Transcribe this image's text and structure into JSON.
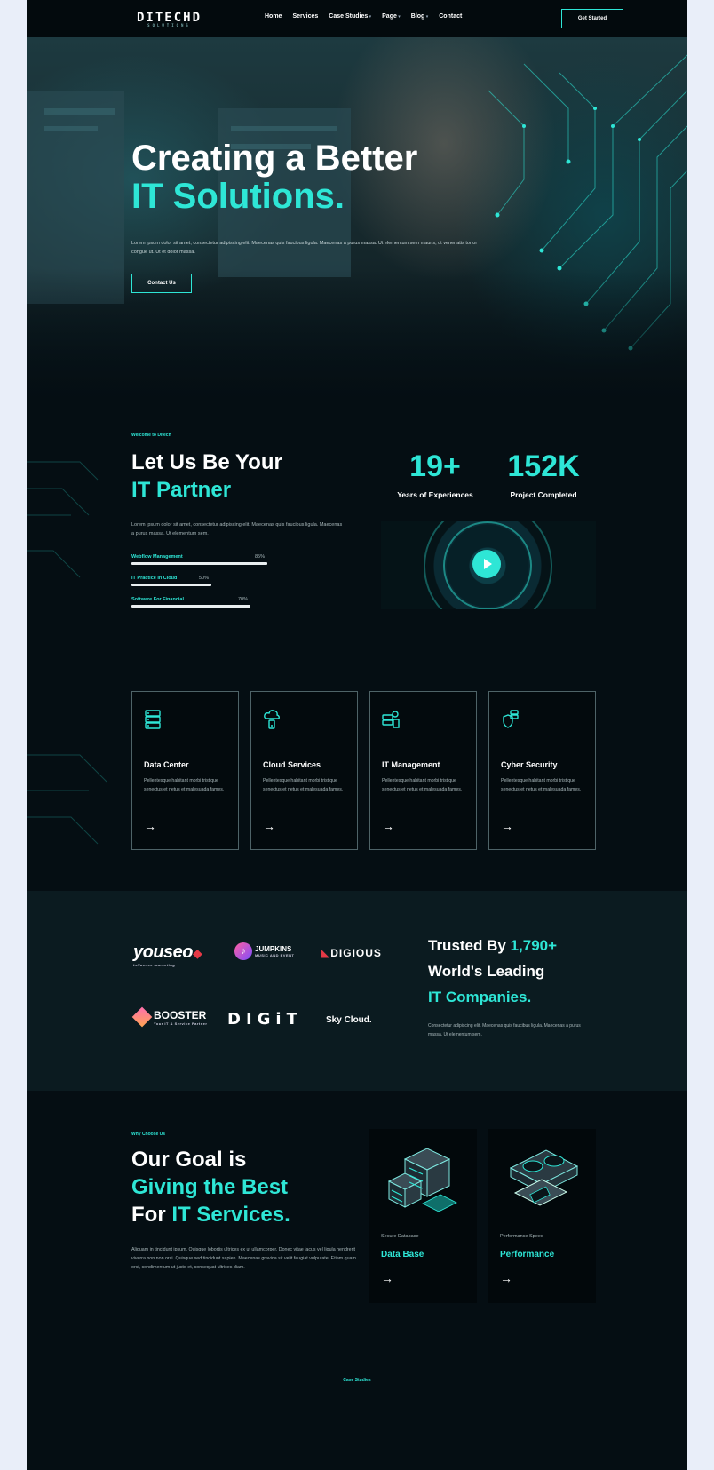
{
  "nav": {
    "logo": "DITECHD",
    "logo_tag": "SOLUTIONS",
    "menu": [
      "Home",
      "Services",
      "Case Studies",
      "Page",
      "Blog",
      "Contact"
    ],
    "menu_has_caret": [
      false,
      false,
      true,
      true,
      true,
      false
    ],
    "cta": "Get Started"
  },
  "hero": {
    "title_line1": "Creating a Better",
    "title_line2": "IT Solutions.",
    "lead": "Lorem ipsum dolor sit amet, consectetur adipiscing elit. Maecenas quis faucibus ligula. Maecenas a purus massa. Ut elementum sem mauris, ut venenatis tortor congue ut. Ut et dolor massa.",
    "cta": "Contact Us"
  },
  "partner": {
    "eyebrow": "Welcome to Ditech",
    "title_line1": "Let Us Be Your",
    "title_line2": "IT Partner",
    "text": "Lorem ipsum dolor sit amet, consectetur adipiscing elit. Maecenas quis faucibus ligula. Maecenas a purus massa. Ut elementum sem.",
    "skills": [
      {
        "label": "Webflow Management",
        "percent_text": "85%",
        "value": 0.85
      },
      {
        "label": "IT Practice In Cloud",
        "percent_text": "50%",
        "value": 0.5
      },
      {
        "label": "Software For Financial",
        "percent_text": "70%",
        "value": 0.7
      }
    ],
    "stats": [
      {
        "value": "19+",
        "label": "Years of Experiences"
      },
      {
        "value": "152K",
        "label": "Project Completed"
      }
    ]
  },
  "services": [
    {
      "icon": "data-center-icon",
      "title": "Data Center",
      "desc": "Pellentesque habitant morbi tristique senectus et netus et malesuada fames."
    },
    {
      "icon": "cloud-services-icon",
      "title": "Cloud Services",
      "desc": "Pellentesque habitant morbi tristique senectus et netus et malesuada fames."
    },
    {
      "icon": "it-management-icon",
      "title": "IT Management",
      "desc": "Pellentesque habitant morbi tristique senectus et netus et malesuada fames."
    },
    {
      "icon": "cyber-security-icon",
      "title": "Cyber Security",
      "desc": "Pellentesque habitant morbi tristique senectus et netus et malesuada fames."
    }
  ],
  "trusted": {
    "line1_prefix": "Trusted By ",
    "line1_count": "1,790+",
    "line2": "World's Leading",
    "line3": "IT Companies.",
    "text": "Consectetur adipiscing elit. Maecenas quis faucibus ligula. Maecenas a purus massa. Ut elementum sem.",
    "brands": {
      "youseo": "youseo",
      "youseo_sub": "Influence marketing",
      "jumpkins": "JUMPKINS",
      "jumpkins_sub": "MUSIC AND EVENT",
      "digious": "DIGIOUS",
      "booster": "BOOSTER",
      "booster_sub": "Your IT & Service Partner",
      "digit": "DIGiT",
      "skycloud": "Sky Cloud."
    }
  },
  "goal": {
    "eyebrow": "Why Choose Us",
    "line1": "Our Goal is",
    "line2": "Giving the Best",
    "line3_prefix": "For ",
    "line3_accent": "IT Services.",
    "text": "Aliquam in tincidunt ipsum. Quisque lobortis ultrices ex ut ullamcorper. Donec vitae lacus vel ligula hendrerit viverra non non orci. Quisque sed tincidunt sapien. Maecenas gravida sit velit feugiat vulputate. Etiam quam orci, condimentum ut justo et, consequat ultrices diam.",
    "features": [
      {
        "sub": "Secure Database",
        "title": "Data Base"
      },
      {
        "sub": "Performance Speed",
        "title": "Performance"
      }
    ]
  },
  "case_studies": {
    "eyebrow": "Case Studies"
  },
  "arrow_glyph": "→",
  "colors": {
    "accent": "#2ee6d6",
    "background": "#050e13",
    "panel": "#0b1b20",
    "outer": "#e9eef9"
  }
}
